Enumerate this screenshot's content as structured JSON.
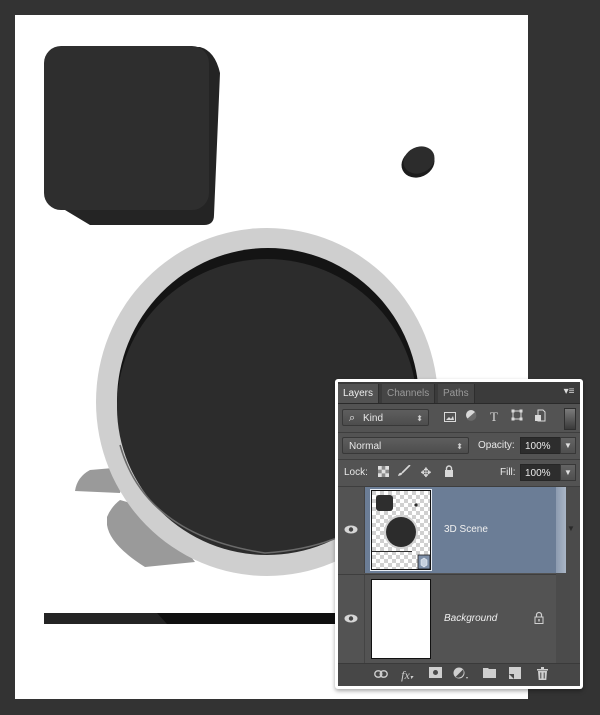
{
  "canvas": {
    "background_color": "#ffffff",
    "workspace_color": "#333333",
    "objects": [
      {
        "name": "rounded-square-3d",
        "color": "#2e2e2e"
      },
      {
        "name": "small-disc-3d",
        "color": "#2c2c2c"
      },
      {
        "name": "large-disc-3d",
        "color": "#2c2c2c",
        "ring_color": "#cfcfcf"
      },
      {
        "name": "ground-shadow",
        "color": "#9a9a9a"
      },
      {
        "name": "base-bar",
        "color": "#111111"
      }
    ]
  },
  "layers_panel": {
    "tabs": [
      {
        "label": "Layers",
        "active": true
      },
      {
        "label": "Channels",
        "active": false
      },
      {
        "label": "Paths",
        "active": false
      }
    ],
    "panel_menu_icon": "panel-menu-icon",
    "filter": {
      "label": "Kind",
      "search_icon": "search-icon",
      "filter_icons": [
        "pixel-layer-filter-icon",
        "adjustment-layer-filter-icon",
        "type-layer-filter-icon",
        "shape-layer-filter-icon",
        "smart-object-filter-icon"
      ]
    },
    "blend_mode": "Normal",
    "opacity_label": "Opacity:",
    "opacity_value": "100%",
    "lock_label": "Lock:",
    "lock_icons": [
      "lock-transparent-pixels-icon",
      "lock-image-pixels-icon",
      "lock-position-icon",
      "lock-all-icon"
    ],
    "fill_label": "Fill:",
    "fill_value": "100%",
    "layers": [
      {
        "name": "3D Scene",
        "selected": true,
        "visible": true,
        "type": "3d",
        "locked": false
      },
      {
        "name": "Background",
        "selected": false,
        "visible": true,
        "type": "background",
        "locked": true
      }
    ],
    "selected_color": "#6b7d96",
    "footer_icons": [
      "link-layers-icon",
      "fx-icon",
      "add-mask-icon",
      "adjustment-layer-icon",
      "new-group-icon",
      "new-layer-icon",
      "delete-layer-icon"
    ],
    "fx_label": "fx"
  }
}
